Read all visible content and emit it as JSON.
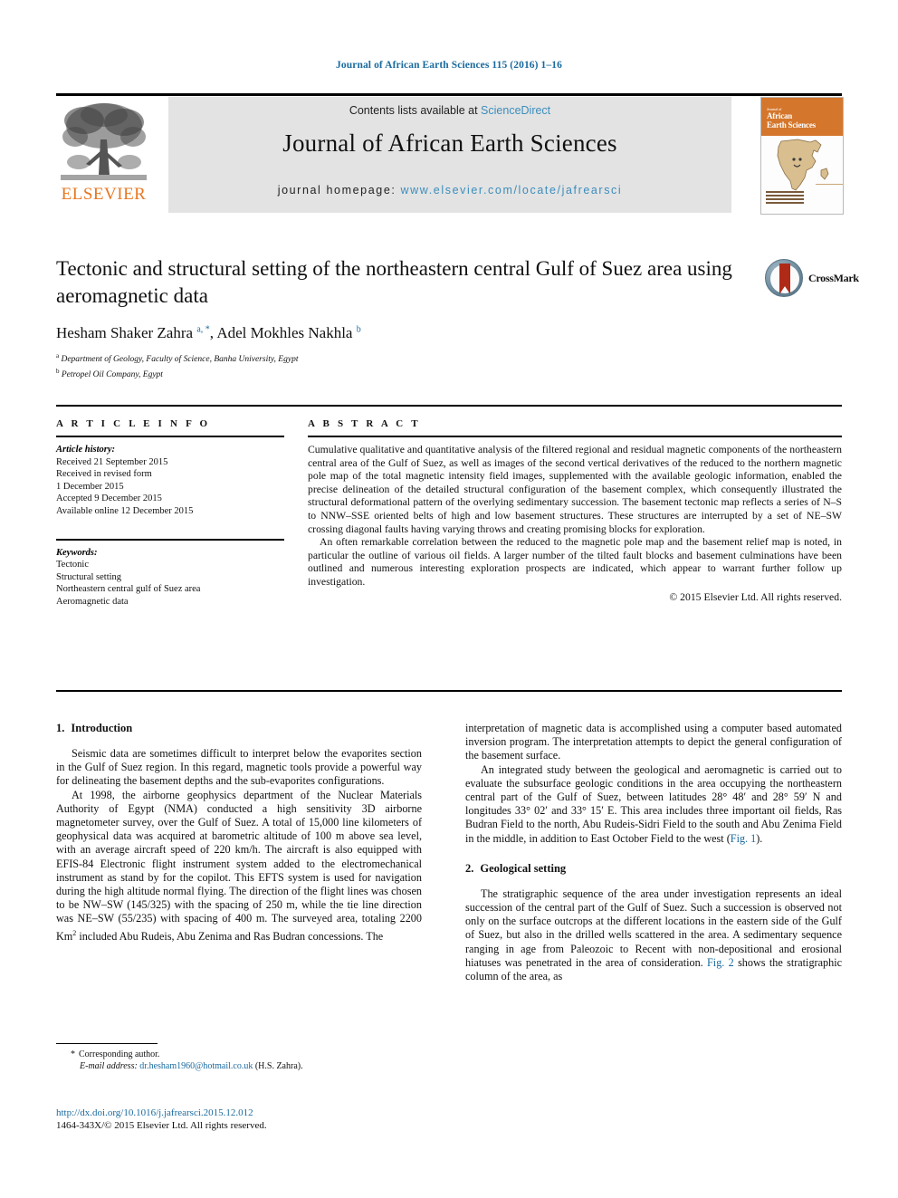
{
  "running_head": "Journal of African Earth Sciences 115 (2016) 1–16",
  "masthead": {
    "contents_prefix": "Contents lists available at ",
    "sciencedirect": "ScienceDirect",
    "journal_title": "Journal of African Earth Sciences",
    "homepage_label": "journal homepage: ",
    "homepage_url": "www.elsevier.com/locate/jafrearsci",
    "elsevier_wordmark": "ELSEVIER",
    "cover_pretitle": "Journal of",
    "cover_title_line1": "African",
    "cover_title_line2": "Earth Sciences",
    "link_color": "#3c8dbc",
    "band_color": "#e3e3e3",
    "elsevier_orange": "#E87722",
    "cover_band_color": "#D4762B"
  },
  "article": {
    "title": "Tectonic and structural setting of the northeastern central Gulf of Suez area using aeromagnetic data",
    "authors_html": "Hesham Shaker Zahra <sup>a, *</sup>, Adel Mokhles Nakhla <sup>b</sup>",
    "affiliation_a": "Department of Geology, Faculty of Science, Banha University, Egypt",
    "affiliation_b": "Petropel Oil Company, Egypt",
    "crossmark_label": "CrossMark"
  },
  "article_info": {
    "heading": "A R T I C L E   I N F O",
    "history_label": "Article history:",
    "history": [
      "Received 21 September 2015",
      "Received in revised form",
      "1 December 2015",
      "Accepted 9 December 2015",
      "Available online 12 December 2015"
    ],
    "keywords_label": "Keywords:",
    "keywords": [
      "Tectonic",
      "Structural setting",
      "Northeastern central gulf of Suez area",
      "Aeromagnetic data"
    ]
  },
  "abstract": {
    "heading": "A B S T R A C T",
    "paragraph_1": "Cumulative qualitative and quantitative analysis of the filtered regional and residual magnetic components of the northeastern central area of the Gulf of Suez, as well as images of the second vertical derivatives of the reduced to the northern magnetic pole map of the total magnetic intensity field images, supplemented with the available geologic information, enabled the precise delineation of the detailed structural configuration of the basement complex, which consequently illustrated the structural deformational pattern of the overlying sedimentary succession. The basement tectonic map reflects a series of N–S to NNW–SSE oriented belts of high and low basement structures. These structures are interrupted by a set of NE–SW crossing diagonal faults having varying throws and creating promising blocks for exploration.",
    "paragraph_2": "An often remarkable correlation between the reduced to the magnetic pole map and the basement relief map is noted, in particular the outline of various oil fields. A larger number of the tilted fault blocks and basement culminations have been outlined and numerous interesting exploration prospects are indicated, which appear to warrant further follow up investigation.",
    "copyright": "© 2015 Elsevier Ltd. All rights reserved."
  },
  "sections": {
    "introduction": {
      "number": "1.",
      "title": "Introduction",
      "p1": "Seismic data are sometimes difficult to interpret below the evaporites section in the Gulf of Suez region. In this regard, magnetic tools provide a powerful way for delineating the basement depths and the sub-evaporites configurations.",
      "p2_part1": "At 1998, the airborne geophysics department of the Nuclear Materials Authority of Egypt (NMA) conducted a high sensitivity 3D airborne magnetometer survey, over the Gulf of Suez. A total of 15,000 line kilometers of geophysical data was acquired at barometric altitude of 100 m above sea level, with an average aircraft speed of 220 km/h. The aircraft is also equipped with EFIS-84 Electronic flight instrument system added to the electromechanical instrument as stand by for the copilot. This EFTS system is used for navigation during the high altitude normal flying. The direction of the flight lines was chosen to be NW–SW (145/325) with the spacing of 250 m, while the tie line direction was NE–SW (55/235) with spacing of 400 m. The surveyed area, totaling 2200 Km",
      "p2_sup": "2",
      "p2_part2": " included Abu Rudeis, Abu Zenima and Ras Budran concessions. The",
      "p3_cont": "interpretation of magnetic data is accomplished using a computer based automated inversion program. The interpretation attempts to depict the general configuration of the basement surface.",
      "p4_a": "An integrated study between the geological and aeromagnetic is carried out to evaluate the subsurface geologic conditions in the area occupying the northeastern central part of the Gulf of Suez, between latitudes 28° 48′ and 28° 59′ N and longitudes 33° 02′ and 33° 15′ E. This area includes three important oil fields, Ras Budran Field to the north, Abu Rudeis-Sidri Field to the south and Abu Zenima Field in the middle, in addition to East October Field to the west (",
      "p4_link": "Fig. 1",
      "p4_b": ")."
    },
    "geological_setting": {
      "number": "2.",
      "title": "Geological setting",
      "p1_a": "The stratigraphic sequence of the area under investigation represents an ideal succession of the central part of the Gulf of Suez. Such a succession is observed not only on the surface outcrops at the different locations in the eastern side of the Gulf of Suez, but also in the drilled wells scattered in the area. A sedimentary sequence ranging in age from Paleozoic to Recent with non-depositional and erosional hiatuses was penetrated in the area of consideration. ",
      "p1_link": "Fig. 2",
      "p1_b": " shows the stratigraphic column of the area, as"
    }
  },
  "footnote": {
    "corresponding_star": "*",
    "corresponding_label": "Corresponding author.",
    "email_label": "E-mail address:",
    "email": "dr.hesham1960@hotmail.co.uk",
    "email_suffix": "(H.S. Zahra).",
    "doi": "http://dx.doi.org/10.1016/j.jafrearsci.2015.12.012",
    "issn_line": "1464-343X/© 2015 Elsevier Ltd. All rights reserved."
  }
}
